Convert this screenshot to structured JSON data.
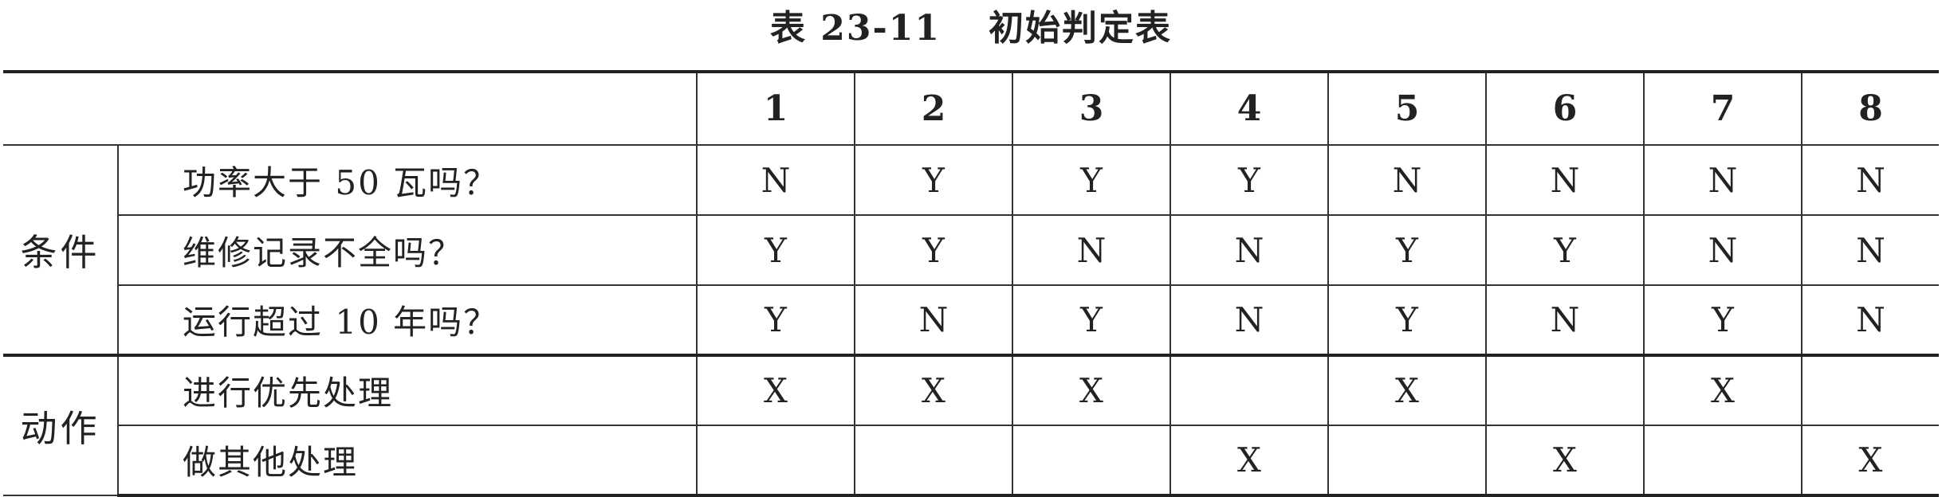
{
  "title": {
    "number": "表 23-11",
    "text": "初始判定表"
  },
  "columns": [
    "1",
    "2",
    "3",
    "4",
    "5",
    "6",
    "7",
    "8"
  ],
  "groups": [
    {
      "label": "条件",
      "rows": [
        {
          "label": "功率大于 50 瓦吗？",
          "values": [
            "N",
            "Y",
            "Y",
            "Y",
            "N",
            "N",
            "N",
            "N"
          ]
        },
        {
          "label": "维修记录不全吗？",
          "values": [
            "Y",
            "Y",
            "N",
            "N",
            "Y",
            "Y",
            "N",
            "N"
          ]
        },
        {
          "label": "运行超过 10 年吗？",
          "values": [
            "Y",
            "N",
            "Y",
            "N",
            "Y",
            "N",
            "Y",
            "N"
          ]
        }
      ]
    },
    {
      "label": "动作",
      "rows": [
        {
          "label": "进行优先处理",
          "values": [
            "X",
            "X",
            "X",
            "",
            "X",
            "",
            "X",
            ""
          ]
        },
        {
          "label": "做其他处理",
          "values": [
            "",
            "",
            "",
            "X",
            "",
            "X",
            "",
            "X"
          ]
        }
      ]
    }
  ]
}
